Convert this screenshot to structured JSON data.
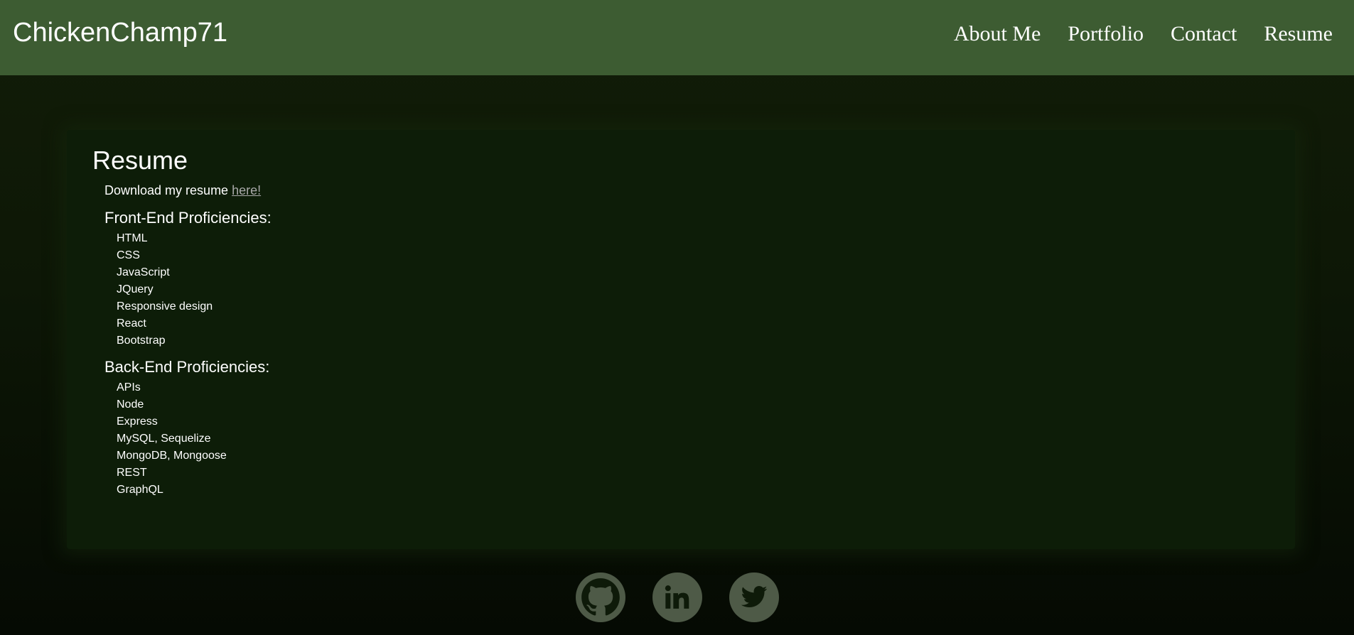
{
  "header": {
    "brand": "ChickenChamp71",
    "nav": [
      "About Me",
      "Portfolio",
      "Contact",
      "Resume"
    ]
  },
  "resume": {
    "title": "Resume",
    "download_prefix": "Download my resume ",
    "download_link": "here!",
    "frontend_title": "Front-End Proficiencies:",
    "frontend": [
      "HTML",
      "CSS",
      "JavaScript",
      "JQuery",
      "Responsive design",
      "React",
      "Bootstrap"
    ],
    "backend_title": "Back-End Proficiencies:",
    "backend": [
      "APIs",
      "Node",
      "Express",
      "MySQL, Sequelize",
      "MongoDB, Mongoose",
      "REST",
      "GraphQL"
    ]
  },
  "social": {
    "icons": [
      "github-icon",
      "linkedin-icon",
      "twitter-icon"
    ]
  },
  "colors": {
    "header_bg": "#3d5c32",
    "card_bg": "#0d1d08",
    "social_bg": "#4e5a47",
    "link": "#a9a9a9"
  }
}
